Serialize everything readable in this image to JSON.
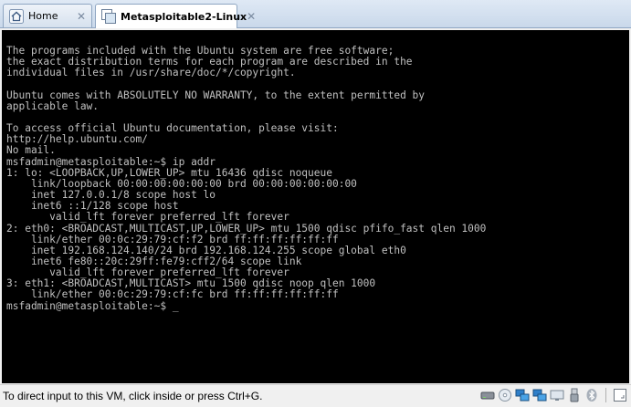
{
  "tabs": [
    {
      "label": "Home",
      "icon": "home-icon"
    },
    {
      "label": "Metasploitable2-Linux",
      "icon": "vm-icon"
    }
  ],
  "console": {
    "lines": [
      "The programs included with the Ubuntu system are free software;",
      "the exact distribution terms for each program are described in the",
      "individual files in /usr/share/doc/*/copyright.",
      "",
      "Ubuntu comes with ABSOLUTELY NO WARRANTY, to the extent permitted by",
      "applicable law.",
      "",
      "To access official Ubuntu documentation, please visit:",
      "http://help.ubuntu.com/",
      "No mail.",
      "msfadmin@metasploitable:~$ ip addr",
      "1: lo: <LOOPBACK,UP,LOWER_UP> mtu 16436 qdisc noqueue",
      "    link/loopback 00:00:00:00:00:00 brd 00:00:00:00:00:00",
      "    inet 127.0.0.1/8 scope host lo",
      "    inet6 ::1/128 scope host",
      "       valid_lft forever preferred_lft forever",
      "2: eth0: <BROADCAST,MULTICAST,UP,LOWER_UP> mtu 1500 qdisc pfifo_fast qlen 1000",
      "    link/ether 00:0c:29:79:cf:f2 brd ff:ff:ff:ff:ff:ff",
      "    inet 192.168.124.140/24 brd 192.168.124.255 scope global eth0",
      "    inet6 fe80::20c:29ff:fe79:cff2/64 scope link",
      "       valid_lft forever preferred_lft forever",
      "3: eth1: <BROADCAST,MULTICAST> mtu 1500 qdisc noop qlen 1000",
      "    link/ether 00:0c:29:79:cf:fc brd ff:ff:ff:ff:ff:ff",
      "msfadmin@metasploitable:~$ _"
    ]
  },
  "statusbar": {
    "text": "To direct input to this VM, click inside or press Ctrl+G.",
    "icons": [
      "hard-disk-icon",
      "cd-drive-icon",
      "network-adapter-icon",
      "network-adapter-2-icon",
      "display-icon",
      "usb-icon",
      "bluetooth-icon",
      "fit-window-icon"
    ]
  }
}
